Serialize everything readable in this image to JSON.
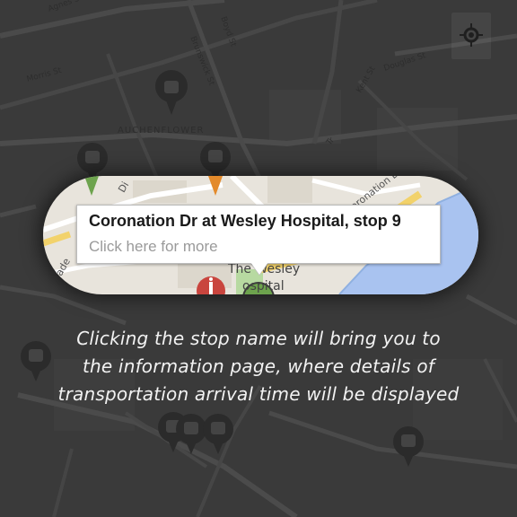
{
  "map": {
    "streets": [
      "Agnes St",
      "Boyd St",
      "Morris St",
      "Brunswick St",
      "Douglas St",
      "AUCHENFLOWER",
      "Kent St",
      "Tr"
    ],
    "spotlight_labels": [
      "Di",
      "Coronation Dr",
      "ade",
      "The Wesley",
      "ospital"
    ],
    "locate_icon": "crosshair-icon",
    "colors": {
      "background": "#3a3a3a",
      "road": "#4a4a4a",
      "road_major": "#565656",
      "map_land": "#e8e4dc",
      "map_water": "#a9c3f0",
      "map_park": "#b7d9a1",
      "map_highway": "#f2d26b",
      "pin_green": "#6da34d",
      "pin_orange": "#e38a2b",
      "pin_red": "#c9453e"
    }
  },
  "popup": {
    "title": "Coronation Dr at Wesley Hospital, stop 9",
    "subtitle": "Click here for more"
  },
  "caption": {
    "lines": [
      "Clicking the stop name will bring you to",
      "the information page, where details of",
      "transportation arrival time will be displayed"
    ]
  }
}
